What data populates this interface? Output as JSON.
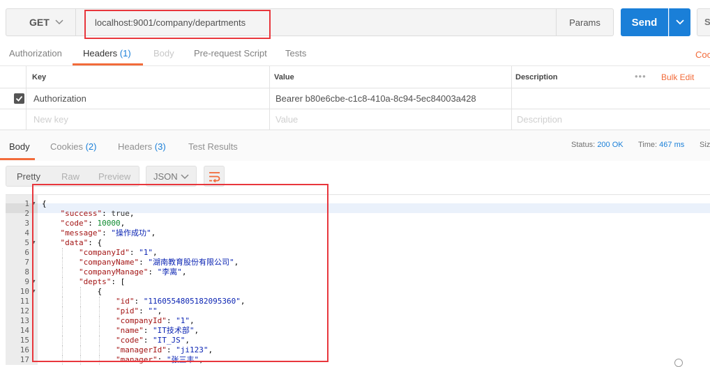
{
  "request": {
    "method": "GET",
    "url": "localhost:9001/company/departments",
    "params_label": "Params",
    "send_label": "Send",
    "save_label": "Sa"
  },
  "request_tabs": [
    {
      "label": "Authorization",
      "count": ""
    },
    {
      "label": "Headers",
      "count": "(1)"
    },
    {
      "label": "Body",
      "count": ""
    },
    {
      "label": "Pre-request Script",
      "count": ""
    },
    {
      "label": "Tests",
      "count": ""
    }
  ],
  "cookies_link": "Coo",
  "headers_table": {
    "columns": {
      "key": "Key",
      "value": "Value",
      "description": "Description"
    },
    "bulk_edit": "Bulk Edit",
    "more": "•••",
    "rows": [
      {
        "key": "Authorization",
        "value": "Bearer b80e6cbe-c1c8-410a-8c94-5ec84003a428",
        "description": ""
      }
    ],
    "placeholders": {
      "key": "New key",
      "value": "Value",
      "description": "Description"
    }
  },
  "response_tabs": [
    {
      "label": "Body",
      "count": ""
    },
    {
      "label": "Cookies",
      "count": "(2)"
    },
    {
      "label": "Headers",
      "count": "(3)"
    },
    {
      "label": "Test Results",
      "count": ""
    }
  ],
  "status": {
    "status_label": "Status:",
    "status_value": "200 OK",
    "time_label": "Time:",
    "time_value": "467 ms",
    "size_label": "Siz"
  },
  "view_modes": [
    "Pretty",
    "Raw",
    "Preview"
  ],
  "format": "JSON",
  "code_lines": [
    {
      "n": "1",
      "fold": true,
      "indent": 0,
      "parts": [
        {
          "t": "p",
          "v": "{"
        }
      ]
    },
    {
      "n": "2",
      "fold": false,
      "indent": 1,
      "parts": [
        {
          "t": "k",
          "v": "\"success\""
        },
        {
          "t": "p",
          "v": ": "
        },
        {
          "t": "b",
          "v": "true"
        },
        {
          "t": "p",
          "v": ","
        }
      ]
    },
    {
      "n": "3",
      "fold": false,
      "indent": 1,
      "parts": [
        {
          "t": "k",
          "v": "\"code\""
        },
        {
          "t": "p",
          "v": ": "
        },
        {
          "t": "n",
          "v": "10000"
        },
        {
          "t": "p",
          "v": ","
        }
      ]
    },
    {
      "n": "4",
      "fold": false,
      "indent": 1,
      "parts": [
        {
          "t": "k",
          "v": "\"message\""
        },
        {
          "t": "p",
          "v": ": "
        },
        {
          "t": "s",
          "v": "\"操作成功\""
        },
        {
          "t": "p",
          "v": ","
        }
      ]
    },
    {
      "n": "5",
      "fold": true,
      "indent": 1,
      "parts": [
        {
          "t": "k",
          "v": "\"data\""
        },
        {
          "t": "p",
          "v": ": {"
        }
      ]
    },
    {
      "n": "6",
      "fold": false,
      "indent": 2,
      "parts": [
        {
          "t": "k",
          "v": "\"companyId\""
        },
        {
          "t": "p",
          "v": ": "
        },
        {
          "t": "s",
          "v": "\"1\""
        },
        {
          "t": "p",
          "v": ","
        }
      ]
    },
    {
      "n": "7",
      "fold": false,
      "indent": 2,
      "parts": [
        {
          "t": "k",
          "v": "\"companyName\""
        },
        {
          "t": "p",
          "v": ": "
        },
        {
          "t": "s",
          "v": "\"湖南教育股份有限公司\""
        },
        {
          "t": "p",
          "v": ","
        }
      ]
    },
    {
      "n": "8",
      "fold": false,
      "indent": 2,
      "parts": [
        {
          "t": "k",
          "v": "\"companyManage\""
        },
        {
          "t": "p",
          "v": ": "
        },
        {
          "t": "s",
          "v": "\"李离\""
        },
        {
          "t": "p",
          "v": ","
        }
      ]
    },
    {
      "n": "9",
      "fold": true,
      "indent": 2,
      "parts": [
        {
          "t": "k",
          "v": "\"depts\""
        },
        {
          "t": "p",
          "v": ": ["
        }
      ]
    },
    {
      "n": "10",
      "fold": true,
      "indent": 3,
      "parts": [
        {
          "t": "p",
          "v": "{"
        }
      ]
    },
    {
      "n": "11",
      "fold": false,
      "indent": 4,
      "parts": [
        {
          "t": "k",
          "v": "\"id\""
        },
        {
          "t": "p",
          "v": ": "
        },
        {
          "t": "s",
          "v": "\"1160554805182095360\""
        },
        {
          "t": "p",
          "v": ","
        }
      ]
    },
    {
      "n": "12",
      "fold": false,
      "indent": 4,
      "parts": [
        {
          "t": "k",
          "v": "\"pid\""
        },
        {
          "t": "p",
          "v": ": "
        },
        {
          "t": "s",
          "v": "\"\""
        },
        {
          "t": "p",
          "v": ","
        }
      ]
    },
    {
      "n": "13",
      "fold": false,
      "indent": 4,
      "parts": [
        {
          "t": "k",
          "v": "\"companyId\""
        },
        {
          "t": "p",
          "v": ": "
        },
        {
          "t": "s",
          "v": "\"1\""
        },
        {
          "t": "p",
          "v": ","
        }
      ]
    },
    {
      "n": "14",
      "fold": false,
      "indent": 4,
      "parts": [
        {
          "t": "k",
          "v": "\"name\""
        },
        {
          "t": "p",
          "v": ": "
        },
        {
          "t": "s",
          "v": "\"IT技术部\""
        },
        {
          "t": "p",
          "v": ","
        }
      ]
    },
    {
      "n": "15",
      "fold": false,
      "indent": 4,
      "parts": [
        {
          "t": "k",
          "v": "\"code\""
        },
        {
          "t": "p",
          "v": ": "
        },
        {
          "t": "s",
          "v": "\"IT_JS\""
        },
        {
          "t": "p",
          "v": ","
        }
      ]
    },
    {
      "n": "16",
      "fold": false,
      "indent": 4,
      "parts": [
        {
          "t": "k",
          "v": "\"managerId\""
        },
        {
          "t": "p",
          "v": ": "
        },
        {
          "t": "s",
          "v": "\"ji123\""
        },
        {
          "t": "p",
          "v": ","
        }
      ]
    },
    {
      "n": "17",
      "fold": false,
      "indent": 4,
      "parts": [
        {
          "t": "k",
          "v": "\"manager\""
        },
        {
          "t": "p",
          "v": ": "
        },
        {
          "t": "s",
          "v": "\"张三丰\""
        },
        {
          "t": "p",
          "v": ","
        }
      ]
    }
  ],
  "colors": {
    "accent_orange": "#f26b3a",
    "send_blue": "#1a7fd8",
    "highlight_red": "#e8363c"
  }
}
